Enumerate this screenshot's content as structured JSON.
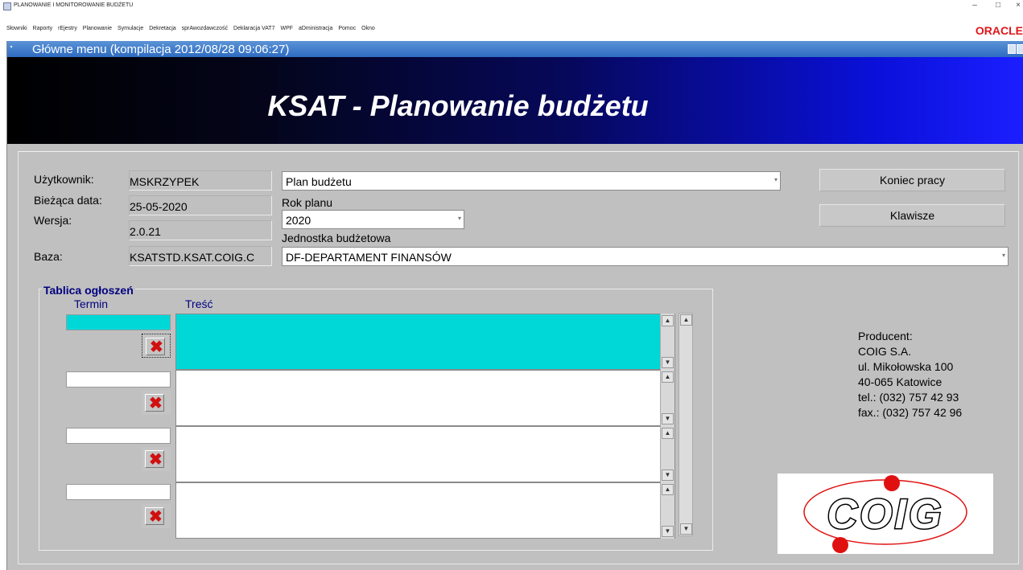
{
  "window": {
    "title": "PLANOWANIE I MONITOROWANIE BUDŻETU",
    "minimize_label": "–",
    "maximize_label": "□",
    "close_label": "×"
  },
  "menu": {
    "items": [
      "Słowniki",
      "Raporty",
      "rEjestry",
      "Planowanie",
      "Symulacje",
      "Dekretacja",
      "sprAwozdawczość",
      "Deklaracja VAT7",
      "WPF",
      "aDministracja",
      "Pomoc",
      "Okno"
    ],
    "brand": "ORACLE"
  },
  "inner_window": {
    "title": "Główne menu (kompilacja 2012/08/28 09:06:27)"
  },
  "banner": {
    "title": "KSAT - Planowanie budżetu"
  },
  "info": {
    "user_label": "Użytkownik:",
    "user_value": "MSKRZYPEK",
    "date_label": "Bieżąca data:",
    "date_value": "25-05-2020",
    "version_label": "Wersja:",
    "version_value": "2.0.21",
    "db_label": "Baza:",
    "db_value": "KSATSTD.KSAT.COIG.C"
  },
  "form": {
    "module_value": "Plan budżetu",
    "year_label": "Rok planu",
    "year_value": "2020",
    "unit_label": "Jednostka budżetowa",
    "unit_value": "DF-DEPARTAMENT FINANSÓW"
  },
  "buttons": {
    "exit_label": "Koniec pracy",
    "keys_label": "Klawisze"
  },
  "board": {
    "title": "Tablica ogłoszeń",
    "col_term": "Termin",
    "col_content": "Treść",
    "rows": [
      {
        "term": "",
        "content": ""
      },
      {
        "term": "",
        "content": ""
      },
      {
        "term": "",
        "content": ""
      },
      {
        "term": "",
        "content": ""
      }
    ]
  },
  "producer": {
    "line1": "Producent:",
    "line2": "COIG S.A.",
    "line3": "ul. Mikołowska 100",
    "line4": "40-065 Katowice",
    "line5": "tel.: (032) 757 42 93",
    "line6": "fax.: (032) 757 42 96",
    "logo_text": "COIG"
  },
  "colors": {
    "accent_active": "#00d8d8",
    "title_blue": "#2e6cc2",
    "oracle_red": "#e0161a",
    "logo_red": "#e01010"
  }
}
